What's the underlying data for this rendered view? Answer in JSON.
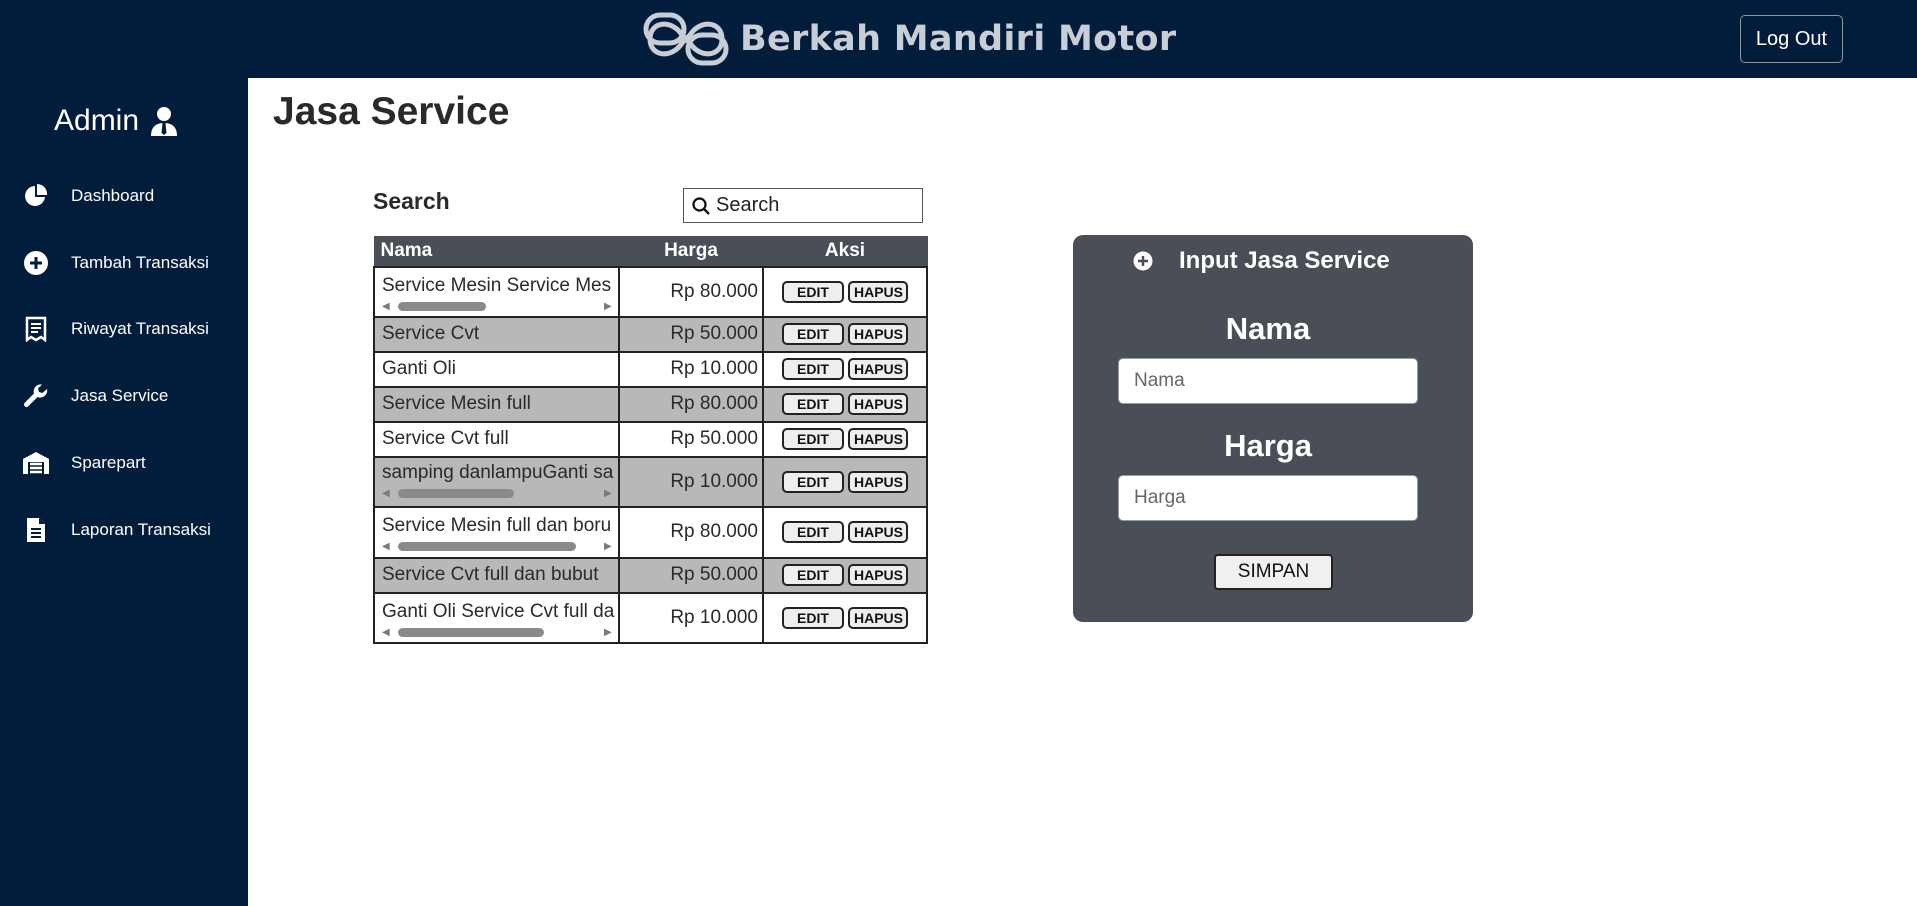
{
  "header": {
    "brand_name": "Berkah Mandiri Motor",
    "logout_label": "Log Out"
  },
  "sidebar": {
    "user_label": "Admin",
    "items": [
      {
        "label": "Dashboard",
        "icon": "pie-chart-icon"
      },
      {
        "label": "Tambah Transaksi",
        "icon": "plus-circle-icon"
      },
      {
        "label": "Riwayat Transaksi",
        "icon": "receipt-icon"
      },
      {
        "label": "Jasa Service",
        "icon": "wrench-icon"
      },
      {
        "label": "Sparepart",
        "icon": "warehouse-icon"
      },
      {
        "label": "Laporan Transaksi",
        "icon": "document-icon"
      }
    ]
  },
  "main": {
    "page_title": "Jasa Service",
    "search": {
      "label": "Search",
      "placeholder": "Search"
    },
    "table": {
      "columns": [
        "Nama",
        "Harga",
        "Aksi"
      ],
      "rows": [
        {
          "nama": "Service Mesin Service Mes",
          "harga": "Rp 80.000"
        },
        {
          "nama": "Service Cvt",
          "harga": "Rp 50.000"
        },
        {
          "nama": "Ganti Oli",
          "harga": "Rp 10.000"
        },
        {
          "nama": "Service Mesin full",
          "harga": "Rp 80.000"
        },
        {
          "nama": "Service Cvt full",
          "harga": "Rp 50.000"
        },
        {
          "nama": "samping danlampuGanti sa",
          "harga": "Rp 10.000"
        },
        {
          "nama": "Service Mesin full dan boru",
          "harga": "Rp 80.000"
        },
        {
          "nama": "Service Cvt full dan bubut",
          "harga": "Rp 50.000"
        },
        {
          "nama": "Ganti Oli Service Cvt full da",
          "harga": "Rp 10.000"
        }
      ],
      "edit_label": "EDIT",
      "delete_label": "HAPUS"
    }
  },
  "form": {
    "title": "Input Jasa Service",
    "nama_label": "Nama",
    "nama_placeholder": "Nama",
    "harga_label": "Harga",
    "harga_placeholder": "Harga",
    "submit_label": "SIMPAN"
  },
  "colors": {
    "navy": "#021d3c",
    "panel": "#4a4e56",
    "row_alt": "#b8b8b8"
  }
}
